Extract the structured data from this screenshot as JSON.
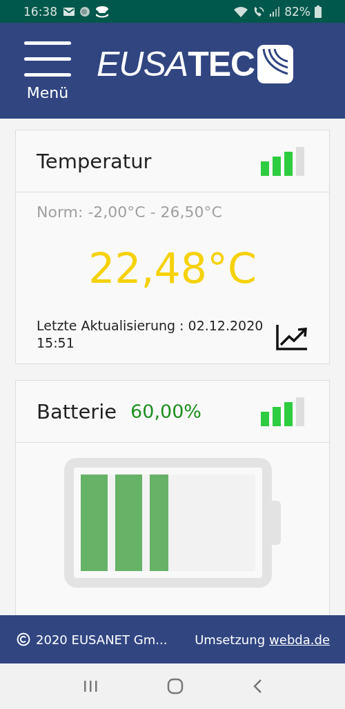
{
  "status_bar": {
    "time": "16:38",
    "battery": "82%"
  },
  "header": {
    "menu_label": "Menü",
    "logo_italic": "EUSA",
    "logo_upright": "TEC"
  },
  "cards": [
    {
      "kind": "temperature",
      "title": "Temperatur",
      "signal": {
        "level": 0.75
      },
      "norm": "Norm: -2,00°C - 26,50°C",
      "value": "22,48°C",
      "updated": "Letzte Aktualisierung : 02.12.2020 15:51"
    },
    {
      "kind": "battery",
      "title": "Batterie",
      "value": "60,00%",
      "signal": {
        "level": 0.75
      },
      "level": 0.5
    }
  ],
  "footer": {
    "copyright": "2020 EUSANET Gm...",
    "credit": "Umsetzung",
    "link": "webda.de"
  }
}
